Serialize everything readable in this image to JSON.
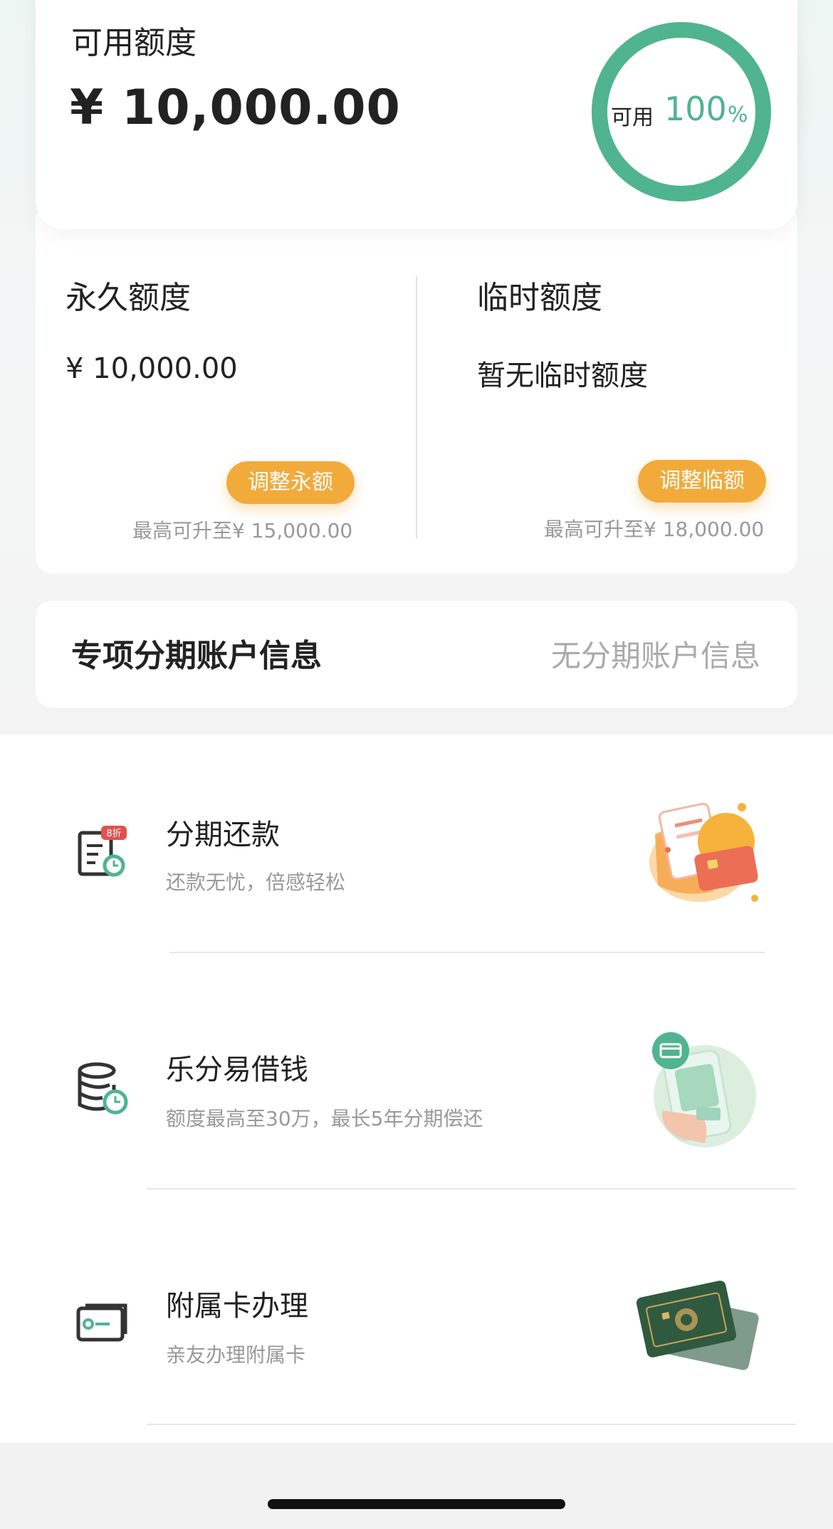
{
  "available": {
    "title": "可用额度",
    "amount": "¥ 10,000.00",
    "ring_label": "可用",
    "ring_value": "100",
    "ring_unit": "%",
    "ring_fraction": 1.0,
    "accent": "#4fb48f"
  },
  "quota": {
    "permanent": {
      "title": "永久额度",
      "amount": "¥ 10,000.00",
      "button": "调整永额",
      "note": "最高可升至¥ 15,000.00"
    },
    "temporary": {
      "title": "临时额度",
      "amount": "暂无临时额度",
      "button": "调整临额",
      "note": "最高可升至¥ 18,000.00"
    },
    "button_color": "#f2aa3a"
  },
  "installment_account": {
    "title": "专项分期账户信息",
    "status": "无分期账户信息"
  },
  "services": [
    {
      "title": "分期还款",
      "subtitle": "还款无忧，倍感轻松",
      "icon": "installment-bill-icon",
      "badge": "8折",
      "illustration": "card-bill-illustration"
    },
    {
      "title": "乐分易借钱",
      "subtitle": "额度最高至30万，最长5年分期偿还",
      "icon": "coin-stack-clock-icon",
      "illustration": "phone-hand-illustration"
    },
    {
      "title": "附属卡办理",
      "subtitle": "亲友办理附属卡",
      "icon": "card-icon",
      "illustration": "credit-cards-illustration"
    }
  ]
}
